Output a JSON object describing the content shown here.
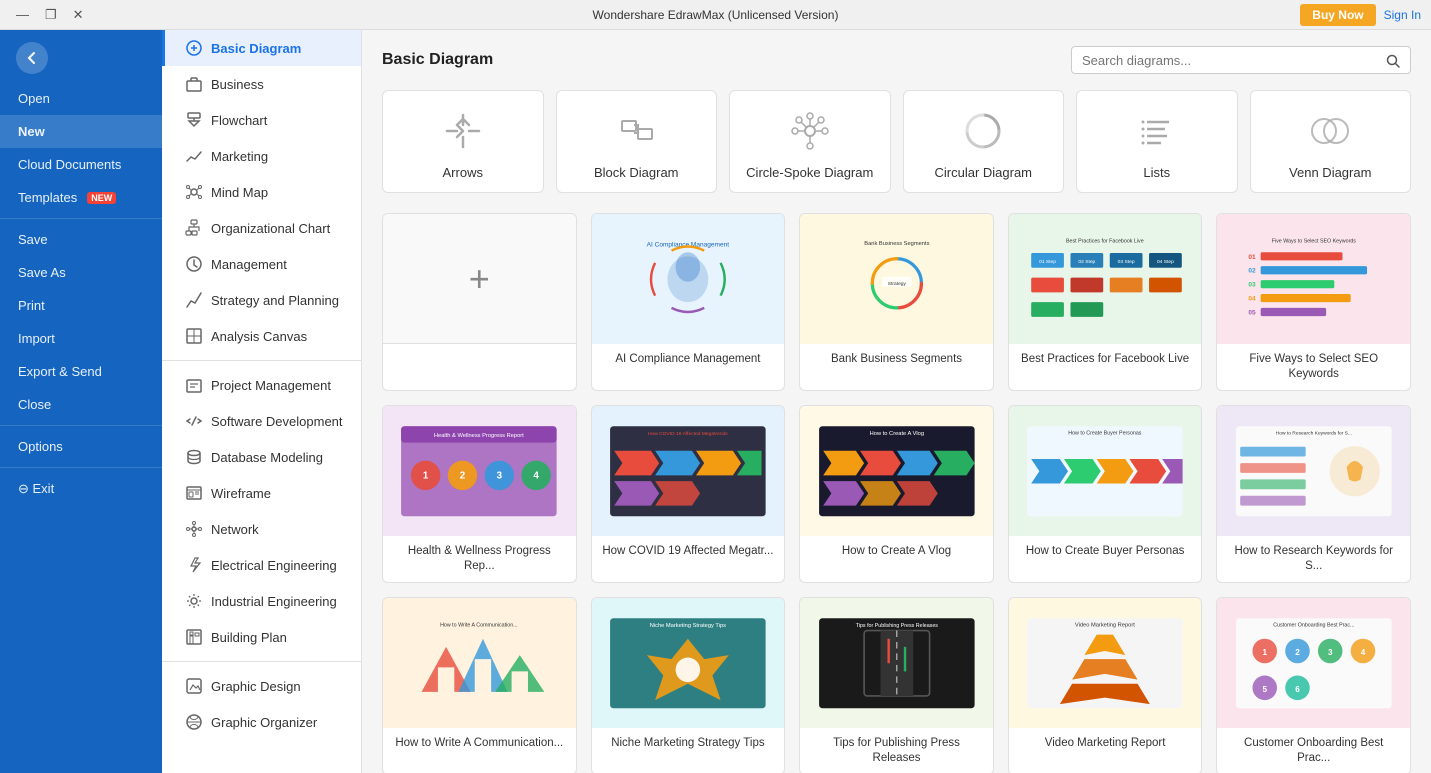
{
  "titlebar": {
    "title": "Wondershare EdrawMax (Unlicensed Version)",
    "controls": [
      "—",
      "❐",
      "✕"
    ],
    "buy_now": "Buy Now",
    "sign_in": "Sign In"
  },
  "sidebar": {
    "logo_icon": "←",
    "items": [
      {
        "id": "open",
        "label": "Open"
      },
      {
        "id": "new",
        "label": "New",
        "active": true
      },
      {
        "id": "cloud",
        "label": "Cloud Documents"
      },
      {
        "id": "templates",
        "label": "Templates",
        "badge": "NEW"
      },
      {
        "id": "save",
        "label": "Save"
      },
      {
        "id": "saveas",
        "label": "Save As"
      },
      {
        "id": "print",
        "label": "Print"
      },
      {
        "id": "import",
        "label": "Import"
      },
      {
        "id": "export",
        "label": "Export & Send"
      },
      {
        "id": "close",
        "label": "Close"
      },
      {
        "id": "options",
        "label": "Options"
      },
      {
        "id": "exit",
        "label": "⊖ Exit"
      }
    ]
  },
  "secondary_nav": {
    "items": [
      {
        "id": "basic",
        "label": "Basic Diagram",
        "active": true,
        "icon": "basic"
      },
      {
        "id": "business",
        "label": "Business",
        "icon": "business"
      },
      {
        "id": "flowchart",
        "label": "Flowchart",
        "icon": "flowchart"
      },
      {
        "id": "marketing",
        "label": "Marketing",
        "icon": "marketing"
      },
      {
        "id": "mindmap",
        "label": "Mind Map",
        "icon": "mindmap"
      },
      {
        "id": "orgchart",
        "label": "Organizational Chart",
        "icon": "orgchart"
      },
      {
        "id": "management",
        "label": "Management",
        "icon": "management"
      },
      {
        "id": "strategy",
        "label": "Strategy and Planning",
        "icon": "strategy"
      },
      {
        "id": "analysis",
        "label": "Analysis Canvas",
        "icon": "analysis"
      },
      {
        "id": "project",
        "label": "Project Management",
        "icon": "project"
      },
      {
        "id": "software",
        "label": "Software Development",
        "icon": "software"
      },
      {
        "id": "database",
        "label": "Database Modeling",
        "icon": "database"
      },
      {
        "id": "wireframe",
        "label": "Wireframe",
        "icon": "wireframe"
      },
      {
        "id": "network",
        "label": "Network",
        "icon": "network"
      },
      {
        "id": "electrical",
        "label": "Electrical Engineering",
        "icon": "electrical"
      },
      {
        "id": "industrial",
        "label": "Industrial Engineering",
        "icon": "industrial"
      },
      {
        "id": "building",
        "label": "Building Plan",
        "icon": "building"
      },
      {
        "id": "graphic",
        "label": "Graphic Design",
        "icon": "graphic"
      },
      {
        "id": "organizer",
        "label": "Graphic Organizer",
        "icon": "organizer"
      }
    ]
  },
  "main": {
    "title": "Basic Diagram",
    "search_placeholder": "Search diagrams...",
    "categories": [
      {
        "id": "arrows",
        "label": "Arrows",
        "icon": "arrows"
      },
      {
        "id": "block",
        "label": "Block Diagram",
        "icon": "block"
      },
      {
        "id": "circle-spoke",
        "label": "Circle-Spoke Diagram",
        "icon": "circle-spoke"
      },
      {
        "id": "circular",
        "label": "Circular Diagram",
        "icon": "circular"
      },
      {
        "id": "lists",
        "label": "Lists",
        "icon": "lists"
      },
      {
        "id": "venn",
        "label": "Venn Diagram",
        "icon": "venn"
      }
    ],
    "templates": [
      {
        "id": "new",
        "label": "",
        "is_new": true
      },
      {
        "id": "ai-compliance",
        "label": "AI Compliance Management",
        "color": "#e8f4fd"
      },
      {
        "id": "bank-business",
        "label": "Bank Business Segments",
        "color": "#fff8e1"
      },
      {
        "id": "facebook-live",
        "label": "Best Practices for Facebook Live",
        "color": "#e8f5e9"
      },
      {
        "id": "seo-keywords",
        "label": "Five Ways to Select SEO Keywords",
        "color": "#fce4ec"
      },
      {
        "id": "health-wellness",
        "label": "Health & Wellness Progress Rep...",
        "color": "#f3e5f5"
      },
      {
        "id": "covid19",
        "label": "How COVID 19 Affected Megatr...",
        "color": "#e3f2fd"
      },
      {
        "id": "vlog",
        "label": "How to Create A Vlog",
        "color": "#fff9e6"
      },
      {
        "id": "buyer-personas",
        "label": "How to Create Buyer Personas",
        "color": "#e8f5e9"
      },
      {
        "id": "research-keywords",
        "label": "How to Research Keywords for S...",
        "color": "#ede7f6"
      },
      {
        "id": "communications",
        "label": "How to Write A Communication...",
        "color": "#fff3e0"
      },
      {
        "id": "niche-marketing",
        "label": "Niche Marketing Strategy Tips",
        "color": "#e0f7fa"
      },
      {
        "id": "press-releases",
        "label": "Tips for Publishing Press Releases",
        "color": "#f1f8e9"
      },
      {
        "id": "video-marketing",
        "label": "Video Marketing Report",
        "color": "#fff8e1"
      },
      {
        "id": "customer-onboarding",
        "label": "Customer Onboarding Best Prac...",
        "color": "#fce4ec"
      }
    ]
  }
}
